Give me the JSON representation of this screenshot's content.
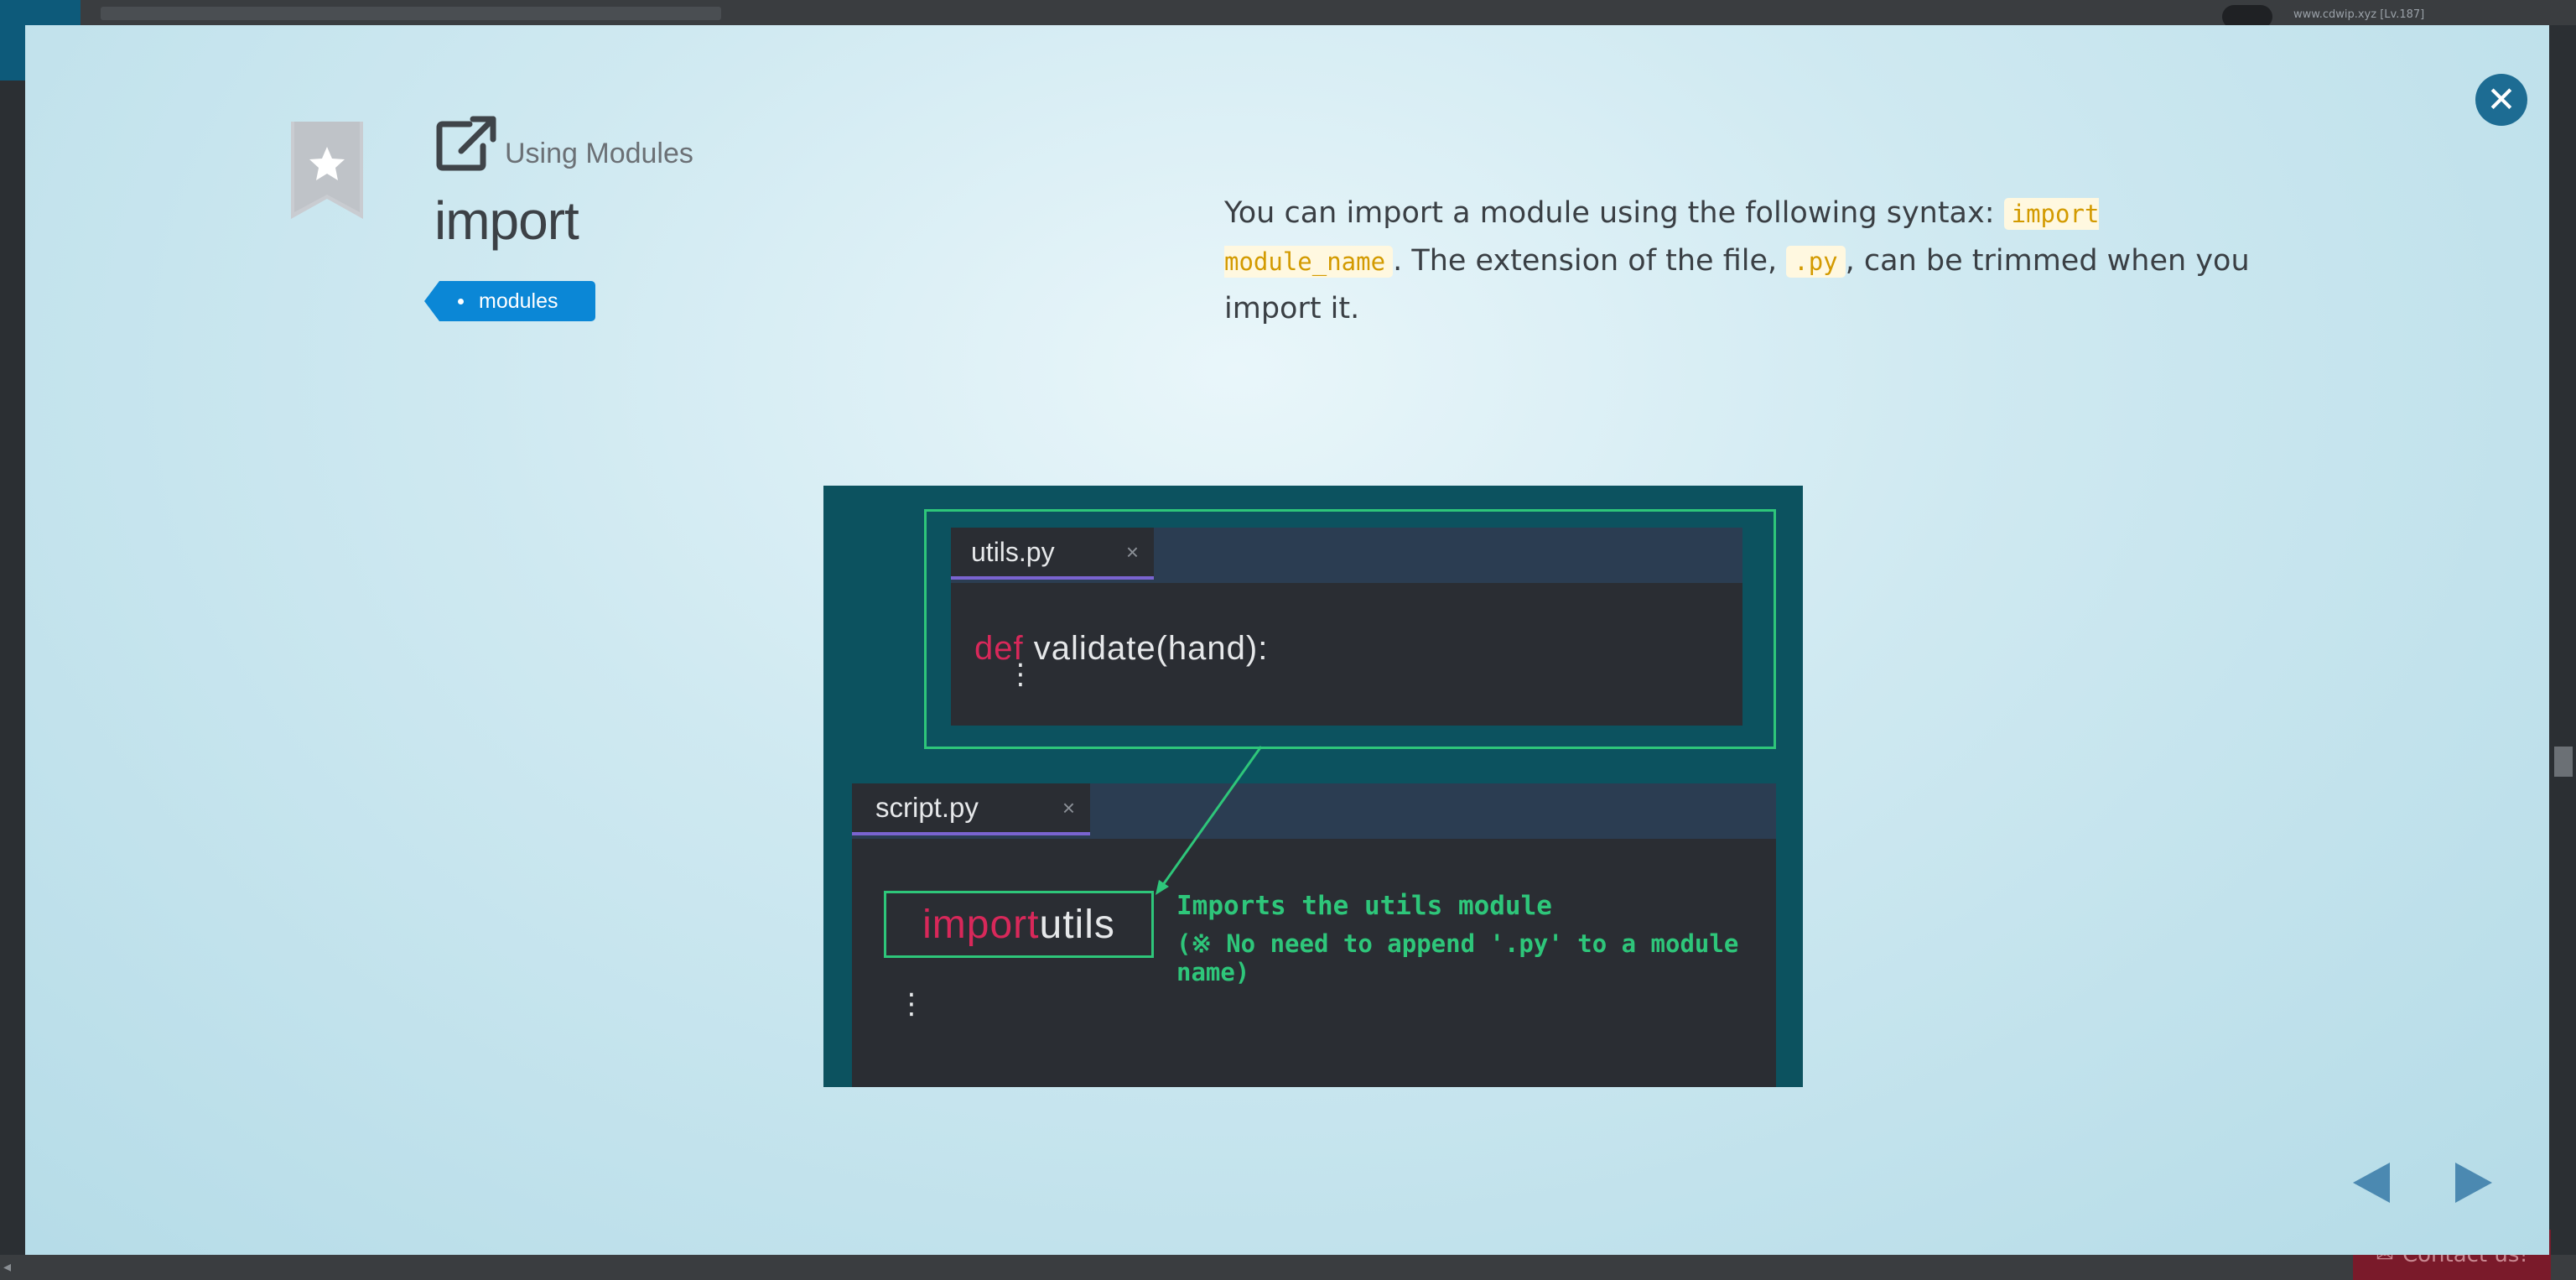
{
  "background": {
    "user_text": "www.cdwip.xyz [Lv.187]",
    "contact_label": "Contact us!"
  },
  "card": {
    "section": "Using Modules",
    "title": "import",
    "tag": "modules",
    "description": {
      "part1": "You can import a module using the following syntax: ",
      "code1": "import module_name",
      "part2": ". The extension of the file, ",
      "code2": ".py",
      "part3": ", can be trimmed when you import it."
    }
  },
  "illustration": {
    "file1": {
      "tab": "utils.py",
      "close": "×",
      "keyword": "def",
      "code": " validate(hand):",
      "ellipsis": "⋮"
    },
    "file2": {
      "tab": "script.py",
      "close": "×",
      "keyword": "import",
      "code": " utils",
      "ellipsis": "⋮"
    },
    "note_line1": "Imports the utils module",
    "note_line2": "(※ No need to append '.py' to a module name)"
  },
  "colors": {
    "accent": "#0b87d6",
    "close_button": "#1d6c93",
    "highlight_green": "#2ec67a",
    "keyword": "#d8285a"
  }
}
